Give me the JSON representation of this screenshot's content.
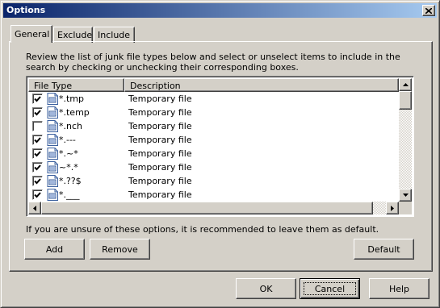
{
  "window": {
    "title": "Options"
  },
  "tabs": [
    {
      "label": "General",
      "active": true
    },
    {
      "label": "Exclude",
      "active": false
    },
    {
      "label": "Include",
      "active": false
    }
  ],
  "intro_text": "Review the list of junk file types below and select or unselect items to include in the search by checking or unchecking their corresponding boxes.",
  "list": {
    "columns": [
      "File Type",
      "Description"
    ],
    "rows": [
      {
        "type": "*.tmp",
        "description": "Temporary file",
        "checked": true
      },
      {
        "type": "*.temp",
        "description": "Temporary file",
        "checked": true
      },
      {
        "type": "*.nch",
        "description": "Temporary file",
        "checked": false
      },
      {
        "type": "*.---",
        "description": "Temporary file",
        "checked": true
      },
      {
        "type": "*.~*",
        "description": "Temporary file",
        "checked": true
      },
      {
        "type": "~*.*",
        "description": "Temporary file",
        "checked": true
      },
      {
        "type": "*.??$",
        "description": "Temporary file",
        "checked": true
      },
      {
        "type": "*.___",
        "description": "Temporary file",
        "checked": true
      }
    ]
  },
  "hint_text": "If you are unsure of these options, it is recommended to leave them as default.",
  "buttons": {
    "add": "Add",
    "remove": "Remove",
    "default": "Default",
    "ok": "OK",
    "cancel": "Cancel",
    "help": "Help"
  }
}
